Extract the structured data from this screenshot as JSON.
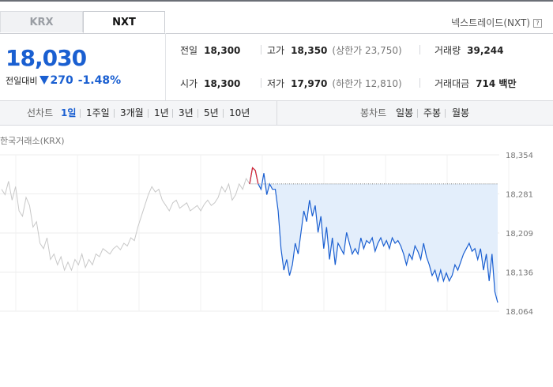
{
  "tabs": [
    {
      "label": "KRX",
      "active": false
    },
    {
      "label": "NXT",
      "active": true
    }
  ],
  "exchange_label": "넥스트레이드(NXT)",
  "help_glyph": "?",
  "quote": {
    "price": "18,030",
    "change_label": "전일대비",
    "change": "270",
    "change_percent": "-1.48%",
    "direction": "down"
  },
  "stats": {
    "prev_close": {
      "label": "전일",
      "value": "18,300"
    },
    "high": {
      "label": "고가",
      "value": "18,350",
      "sub": "(상한가 23,750)"
    },
    "volume": {
      "label": "거래량",
      "value": "39,244"
    },
    "open": {
      "label": "시가",
      "value": "18,300"
    },
    "low": {
      "label": "저가",
      "value": "17,970",
      "sub": "(하한가 12,810)"
    },
    "trade_value": {
      "label": "거래대금",
      "value": "714 백만"
    }
  },
  "toolbar": {
    "line_label": "선차트",
    "periods": [
      "1일",
      "1주일",
      "3개월",
      "1년",
      "3년",
      "5년",
      "10년"
    ],
    "selected_period": "1일",
    "candle_label": "봉차트",
    "candle_periods": [
      "일봉",
      "주봉",
      "월봉"
    ]
  },
  "market_label": "한국거래소(KRX)",
  "colors": {
    "up": "#e0272e",
    "down": "#1a5fd1",
    "krx_line": "#c8c8c8",
    "fill": "#e3eefb"
  },
  "chart_data": {
    "type": "line",
    "y_ticks": [
      "18,354",
      "18,281",
      "18,209",
      "18,136",
      "18,064"
    ],
    "ylim": [
      18064,
      18354
    ],
    "baseline": 18300,
    "grid": true,
    "series": [
      {
        "market": "KRX",
        "values": [
          18290,
          18280,
          18305,
          18270,
          18295,
          18250,
          18240,
          18275,
          18260,
          18220,
          18230,
          18190,
          18180,
          18200,
          18160,
          18170,
          18150,
          18165,
          18140,
          18155,
          18140,
          18160,
          18150,
          18170,
          18145,
          18160,
          18150,
          18170,
          18165,
          18180,
          18175,
          18170,
          18180,
          18185,
          18178,
          18190,
          18185,
          18200,
          18195,
          18220,
          18240,
          18260,
          18280,
          18295,
          18285,
          18290,
          18270,
          18260,
          18250,
          18265,
          18270,
          18255,
          18260,
          18265,
          18250,
          18255,
          18260,
          18250,
          18262,
          18270,
          18260,
          18265,
          18275,
          18295,
          18285,
          18300,
          18270,
          18280,
          18300,
          18290,
          18310,
          18300
        ]
      },
      {
        "market": "NXT",
        "values": [
          18300,
          18330,
          18325,
          18300,
          18290,
          18320,
          18280,
          18300,
          18290,
          18290,
          18250,
          18180,
          18140,
          18160,
          18130,
          18150,
          18190,
          18170,
          18210,
          18250,
          18230,
          18270,
          18240,
          18260,
          18210,
          18240,
          18180,
          18220,
          18160,
          18200,
          18150,
          18190,
          18180,
          18170,
          18210,
          18190,
          18170,
          18180,
          18170,
          18200,
          18180,
          18195,
          18190,
          18200,
          18175,
          18190,
          18200,
          18185,
          18195,
          18180,
          18200,
          18190,
          18195,
          18185,
          18170,
          18150,
          18170,
          18160,
          18185,
          18175,
          18160,
          18190,
          18165,
          18150,
          18130,
          18140,
          18120,
          18140,
          18120,
          18135,
          18120,
          18130,
          18150,
          18140,
          18155,
          18170,
          18180,
          18190,
          18175,
          18180,
          18160,
          18180,
          18140,
          18170,
          18120,
          18170,
          18100,
          18080
        ]
      }
    ]
  }
}
